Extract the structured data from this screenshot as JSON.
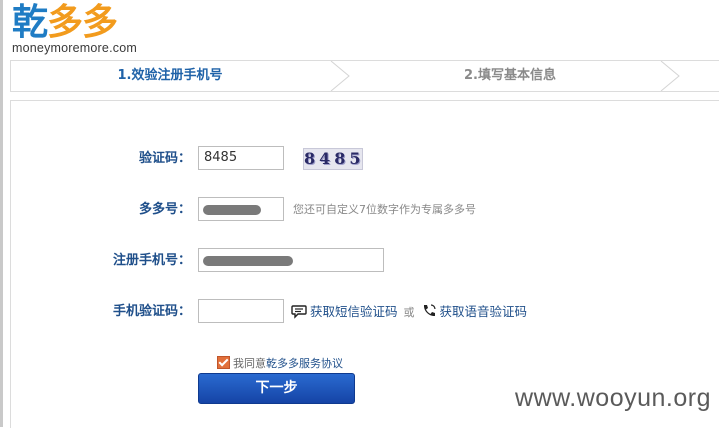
{
  "brand": {
    "logo_char1": "乾",
    "logo_char2": "多多",
    "domain": "moneymoremore.com"
  },
  "steps": [
    {
      "label": "1.效验注册手机号",
      "active": true
    },
    {
      "label": "2.填写基本信息",
      "active": false
    }
  ],
  "form": {
    "captcha": {
      "label": "验证码：",
      "value": "8485",
      "image_text": "8485"
    },
    "duoduo_id": {
      "label": "多多号：",
      "value": "",
      "hint": "您还可自定义7位数字作为专属多多号"
    },
    "phone": {
      "label": "注册手机号：",
      "value": ""
    },
    "sms_code": {
      "label": "手机验证码：",
      "value": "",
      "sms_link": "获取短信验证码",
      "or_text": "或",
      "voice_link": "获取语音验证码"
    },
    "agreement": {
      "prefix": "我同意",
      "link": "乾多多服务协议",
      "checked": true
    },
    "next_button": "下一步"
  },
  "watermark": "www.wooyun.org",
  "colors": {
    "primary": "#1f62a8",
    "logo_blue": "#1f7cc4",
    "logo_orange": "#f29b1d",
    "button": "#1f4fb8"
  }
}
